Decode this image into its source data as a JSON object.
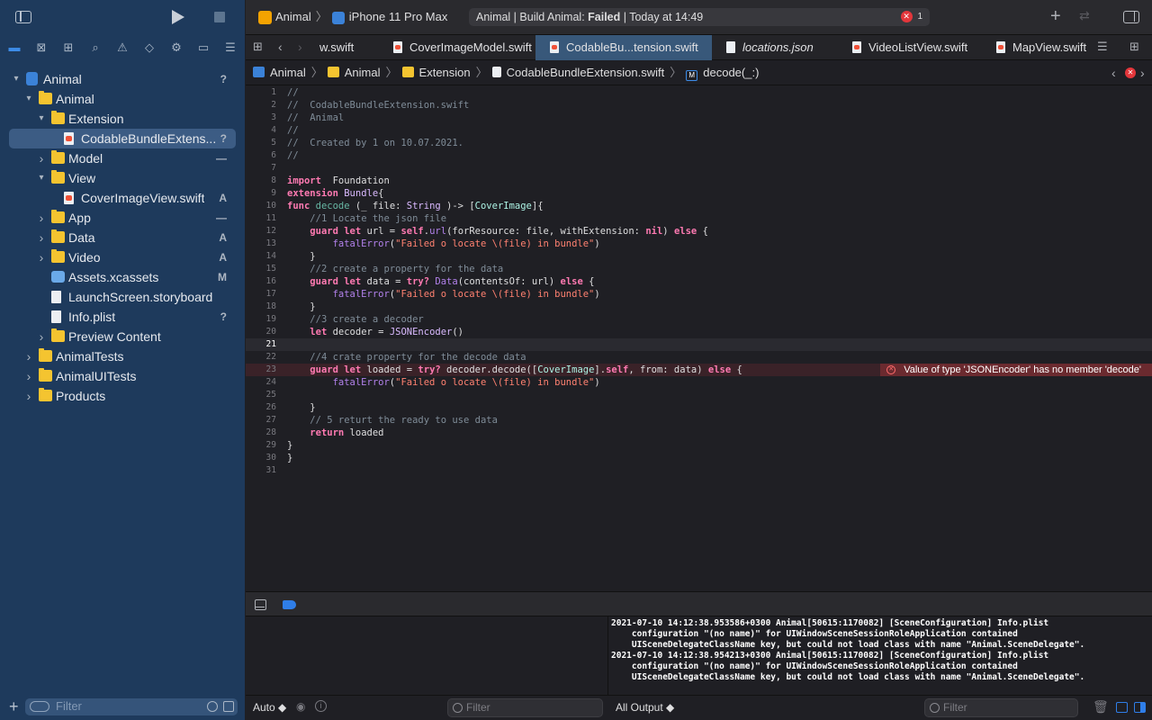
{
  "toolbar": {
    "scheme": "Animal",
    "device": "iPhone 11 Pro Max",
    "status_prefix": "Animal | Build Animal: ",
    "status_result": "Failed",
    "status_suffix": " | Today at 14:49",
    "error_count": "1"
  },
  "tabs": [
    {
      "label": "w.swift",
      "type": "swift"
    },
    {
      "label": "CoverImageModel.swift",
      "type": "swift"
    },
    {
      "label": "CodableBu...tension.swift",
      "type": "swift",
      "active": true
    },
    {
      "label": "locations.json",
      "type": "json"
    },
    {
      "label": "VideoListView.swift",
      "type": "swift"
    },
    {
      "label": "MapView.swift",
      "type": "swift"
    }
  ],
  "jumpbar": {
    "items": [
      "Animal",
      "Animal",
      "Extension",
      "CodableBundleExtension.swift",
      "decode(_:)"
    ]
  },
  "navigator": {
    "items": [
      {
        "label": "Animal",
        "badge": "?",
        "icon": "project",
        "indent": 0,
        "disclosure": "open"
      },
      {
        "label": "Animal",
        "badge": "",
        "icon": "folder",
        "indent": 1,
        "disclosure": "open"
      },
      {
        "label": "Extension",
        "badge": "",
        "icon": "folder",
        "indent": 2,
        "disclosure": "open"
      },
      {
        "label": "CodableBundleExtens...",
        "badge": "?",
        "icon": "swift",
        "indent": 3,
        "disclosure": "",
        "selected": true
      },
      {
        "label": "Model",
        "badge": "—",
        "icon": "folder",
        "indent": 2,
        "disclosure": "closed"
      },
      {
        "label": "View",
        "badge": "",
        "icon": "folder",
        "indent": 2,
        "disclosure": "open"
      },
      {
        "label": "CoverImageView.swift",
        "badge": "A",
        "icon": "swift",
        "indent": 3,
        "disclosure": ""
      },
      {
        "label": "App",
        "badge": "—",
        "icon": "folder",
        "indent": 2,
        "disclosure": "closed"
      },
      {
        "label": "Data",
        "badge": "A",
        "icon": "folder",
        "indent": 2,
        "disclosure": "closed"
      },
      {
        "label": "Video",
        "badge": "A",
        "icon": "folder",
        "indent": 2,
        "disclosure": "closed"
      },
      {
        "label": "Assets.xcassets",
        "badge": "M",
        "icon": "asset",
        "indent": 2,
        "disclosure": ""
      },
      {
        "label": "LaunchScreen.storyboard",
        "badge": "",
        "icon": "file",
        "indent": 2,
        "disclosure": ""
      },
      {
        "label": "Info.plist",
        "badge": "?",
        "icon": "file",
        "indent": 2,
        "disclosure": ""
      },
      {
        "label": "Preview Content",
        "badge": "",
        "icon": "folder",
        "indent": 2,
        "disclosure": "closed"
      },
      {
        "label": "AnimalTests",
        "badge": "",
        "icon": "folder",
        "indent": 1,
        "disclosure": "closed"
      },
      {
        "label": "AnimalUITests",
        "badge": "",
        "icon": "folder",
        "indent": 1,
        "disclosure": "closed"
      },
      {
        "label": "Products",
        "badge": "",
        "icon": "folder",
        "indent": 1,
        "disclosure": "closed"
      }
    ],
    "filter_placeholder": "Filter"
  },
  "editor": {
    "current_line": 21,
    "error_line": 23,
    "error_message": "Value of type 'JSONEncoder' has no member 'decode'",
    "lines": [
      [
        [
          "cm",
          "//"
        ]
      ],
      [
        [
          "cm",
          "//  CodableBundleExtension.swift"
        ]
      ],
      [
        [
          "cm",
          "//  Animal"
        ]
      ],
      [
        [
          "cm",
          "//"
        ]
      ],
      [
        [
          "cm",
          "//  Created by 1 on 10.07.2021."
        ]
      ],
      [
        [
          "cm",
          "//"
        ]
      ],
      [],
      [
        [
          "kw",
          "import"
        ],
        [
          "",
          "  Foundation"
        ]
      ],
      [
        [
          "kw",
          "extension"
        ],
        [
          "",
          " "
        ],
        [
          "ty",
          "Bundle"
        ],
        [
          "",
          "{"
        ]
      ],
      [
        [
          "kw",
          "func"
        ],
        [
          "",
          " "
        ],
        [
          "fn",
          "decode"
        ],
        [
          "",
          " (_ file: "
        ],
        [
          "ty",
          "String"
        ],
        [
          "",
          " )-> ["
        ],
        [
          "ty2",
          "CoverImage"
        ],
        [
          "",
          "]{"
        ]
      ],
      [
        [
          "",
          "    "
        ],
        [
          "cm",
          "//1 Locate the json file"
        ]
      ],
      [
        [
          "",
          "    "
        ],
        [
          "kw",
          "guard let"
        ],
        [
          "",
          " url = "
        ],
        [
          "kw",
          "self"
        ],
        [
          "",
          "."
        ],
        [
          "fn2",
          "url"
        ],
        [
          "",
          "(forResource: file, withExtension: "
        ],
        [
          "kw",
          "nil"
        ],
        [
          "",
          ") "
        ],
        [
          "kw",
          "else"
        ],
        [
          "",
          " {"
        ]
      ],
      [
        [
          "",
          "        "
        ],
        [
          "fn2",
          "fatalError"
        ],
        [
          "",
          "("
        ],
        [
          "str",
          "\"Failed o locate \\(file) in bundle\""
        ],
        [
          "",
          ")"
        ]
      ],
      [
        [
          "",
          "    }"
        ]
      ],
      [
        [
          "",
          "    "
        ],
        [
          "cm",
          "//2 create a property for the data"
        ]
      ],
      [
        [
          "",
          "    "
        ],
        [
          "kw",
          "guard let"
        ],
        [
          "",
          " data = "
        ],
        [
          "kw",
          "try?"
        ],
        [
          "",
          " "
        ],
        [
          "fn2",
          "Data"
        ],
        [
          "",
          "(contentsOf: url) "
        ],
        [
          "kw",
          "else"
        ],
        [
          "",
          " {"
        ]
      ],
      [
        [
          "",
          "        "
        ],
        [
          "fn2",
          "fatalError"
        ],
        [
          "",
          "("
        ],
        [
          "str",
          "\"Failed o locate \\(file) in bundle\""
        ],
        [
          "",
          ")"
        ]
      ],
      [
        [
          "",
          "    }"
        ]
      ],
      [
        [
          "",
          "    "
        ],
        [
          "cm",
          "//3 create a decoder"
        ]
      ],
      [
        [
          "",
          "    "
        ],
        [
          "kw",
          "let"
        ],
        [
          "",
          " decoder = "
        ],
        [
          "ty",
          "JSONEncoder"
        ],
        [
          "",
          "()"
        ]
      ],
      [],
      [
        [
          "",
          "    "
        ],
        [
          "cm",
          "//4 crate property for the decode data"
        ]
      ],
      [
        [
          "",
          "    "
        ],
        [
          "kw",
          "guard let"
        ],
        [
          "",
          " loaded = "
        ],
        [
          "kw",
          "try?"
        ],
        [
          "",
          " decoder.decode(["
        ],
        [
          "ty2",
          "CoverImage"
        ],
        [
          "",
          "]."
        ],
        [
          "kw",
          "self"
        ],
        [
          "",
          ", from: data) "
        ],
        [
          "kw",
          "else"
        ],
        [
          "",
          " {"
        ]
      ],
      [
        [
          "",
          "        "
        ],
        [
          "fn2",
          "fatalError"
        ],
        [
          "",
          "("
        ],
        [
          "str",
          "\"Failed o locate \\(file) in bundle\""
        ],
        [
          "",
          ")"
        ]
      ],
      [],
      [
        [
          "",
          "    }"
        ]
      ],
      [
        [
          "",
          "    "
        ],
        [
          "cm",
          "// 5 returt the ready to use data"
        ]
      ],
      [
        [
          "",
          "    "
        ],
        [
          "kw",
          "return"
        ],
        [
          "",
          " loaded"
        ]
      ],
      [
        [
          "",
          "}"
        ]
      ],
      [
        [
          "",
          "}"
        ]
      ],
      []
    ]
  },
  "debug": {
    "auto_label": "Auto ◆",
    "filter_placeholder": "Filter",
    "all_output_label": "All Output ◆",
    "console_lines": [
      "2021-07-10 14:12:38.953586+0300 Animal[50615:1170082] [SceneConfiguration] Info.plist",
      "    configuration \"(no name)\" for UIWindowSceneSessionRoleApplication contained",
      "    UISceneDelegateClassName key, but could not load class with name \"Animal.SceneDelegate\".",
      "2021-07-10 14:12:38.954213+0300 Animal[50615:1170082] [SceneConfiguration] Info.plist",
      "    configuration \"(no name)\" for UIWindowSceneSessionRoleApplication contained",
      "    UISceneDelegateClassName key, but could not load class with name \"Animal.SceneDelegate\"."
    ]
  }
}
